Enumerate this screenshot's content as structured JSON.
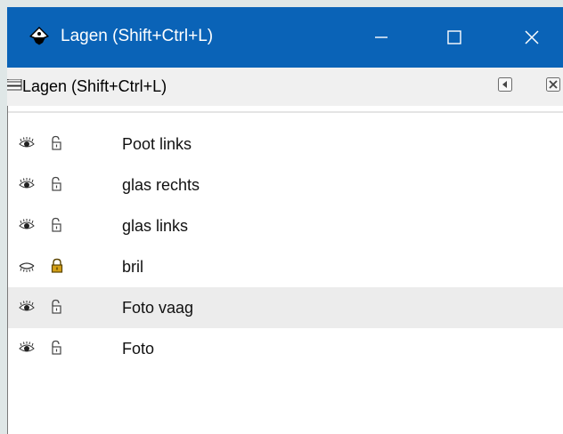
{
  "window": {
    "title": "Lagen (Shift+Ctrl+L)",
    "icon": "inkscape-logo-icon",
    "controls": [
      "minimize-icon",
      "maximize-icon",
      "close-icon"
    ]
  },
  "dock": {
    "title": "Lagen (Shift+Ctrl+L)",
    "buttons": [
      "iconify-icon",
      "close-icon"
    ]
  },
  "layers": [
    {
      "name": "Poot links",
      "visible": true,
      "locked": false,
      "selected": false
    },
    {
      "name": "glas rechts",
      "visible": true,
      "locked": false,
      "selected": false
    },
    {
      "name": "glas links",
      "visible": true,
      "locked": false,
      "selected": false
    },
    {
      "name": "bril",
      "visible": false,
      "locked": true,
      "selected": false
    },
    {
      "name": "Foto vaag",
      "visible": true,
      "locked": false,
      "selected": true
    },
    {
      "name": "Foto",
      "visible": true,
      "locked": false,
      "selected": false
    }
  ],
  "colors": {
    "titlebar": "#0a63b7",
    "lock_locked": "#d4a017",
    "selected_row": "#ececec"
  }
}
